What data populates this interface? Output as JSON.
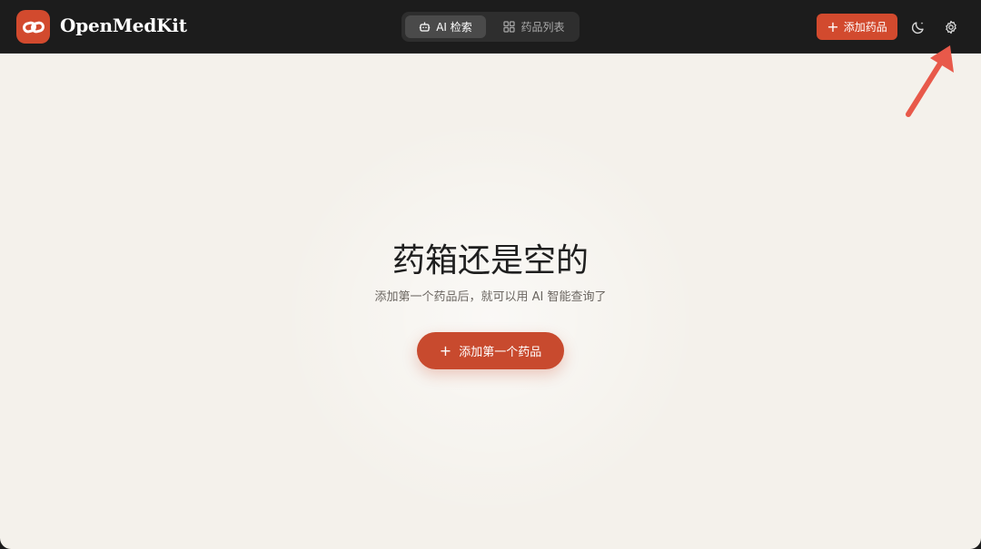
{
  "app": {
    "title": "OpenMedKit",
    "logo_icon": "link-chain-icon",
    "accent": "#d24a2e"
  },
  "nav": {
    "tabs": [
      {
        "label": "AI 检索",
        "icon": "robot-icon",
        "active": true
      },
      {
        "label": "药品列表",
        "icon": "grid-icon",
        "active": false
      }
    ]
  },
  "toolbar": {
    "add_label": "添加药品",
    "theme_icon": "moon-icon",
    "settings_icon": "gear-icon"
  },
  "empty_state": {
    "title": "药箱还是空的",
    "subtitle": "添加第一个药品后，就可以用 AI 智能查询了",
    "cta_label": "添加第一个药品"
  },
  "annotation": {
    "icon": "arrow-pointer-icon",
    "color": "#e8594a"
  }
}
